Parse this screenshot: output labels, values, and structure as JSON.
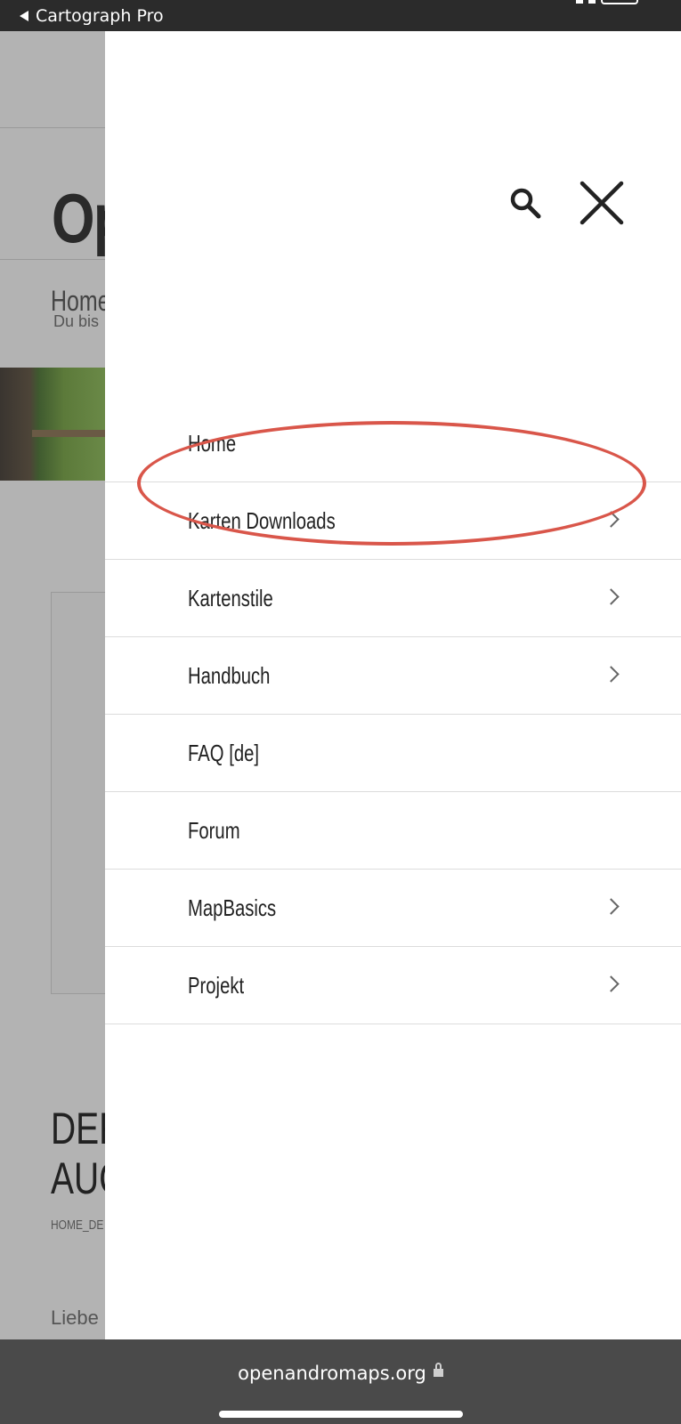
{
  "status_bar": {
    "back_app": "Cartograph Pro"
  },
  "background_page": {
    "logo_text": "Op",
    "breadcrumb_title": "Home",
    "breadcrumb_sub": "Du bis",
    "headline_line1": "DEF",
    "headline_line2": "AUC",
    "post_breadcrumb": "HOME_DE",
    "body_start": "Liebe"
  },
  "menu": {
    "search_icon": "search-icon",
    "close_icon": "close-icon",
    "items": [
      {
        "label": "Home",
        "has_submenu": false
      },
      {
        "label": "Karten Downloads",
        "has_submenu": true,
        "highlighted": true
      },
      {
        "label": "Kartenstile",
        "has_submenu": true
      },
      {
        "label": "Handbuch",
        "has_submenu": true
      },
      {
        "label": "FAQ [de]",
        "has_submenu": false
      },
      {
        "label": "Forum",
        "has_submenu": false
      },
      {
        "label": "MapBasics",
        "has_submenu": true
      },
      {
        "label": "Projekt",
        "has_submenu": true
      }
    ]
  },
  "address_bar": {
    "url": "openandromaps.org",
    "lock_icon": "lock-icon"
  },
  "colors": {
    "highlight_ring": "#d9564a",
    "drawer_bg": "#ffffff",
    "overlay": "#b3b3b3",
    "status_bar": "#2b2b2b",
    "address_bar": "#4a4a4a"
  }
}
